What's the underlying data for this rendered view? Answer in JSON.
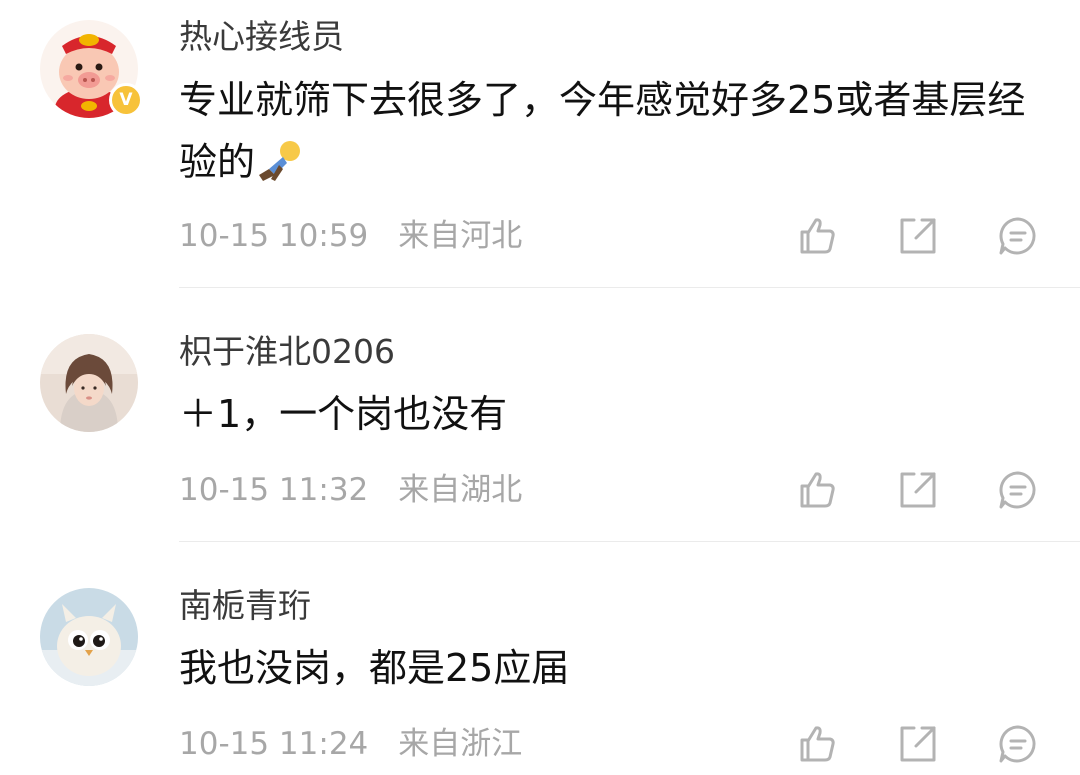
{
  "comments": [
    {
      "username": "热心接线员",
      "text": "专业就筛下去很多了，今年感觉好多25或者基层经验的",
      "emoji": "person-lying-icon",
      "time": "10-15 10:59",
      "location": "来自河北",
      "verified": true,
      "avatar": "pig-avatar"
    },
    {
      "username": "枳于淮北0206",
      "text": "＋1，一个岗也没有",
      "time": "10-15 11:32",
      "location": "来自湖北",
      "verified": false,
      "avatar": "girl-photo-avatar"
    },
    {
      "username": "南栀青珩",
      "text": "我也没岗，都是25应届",
      "time": "10-15 11:24",
      "location": "来自浙江",
      "verified": false,
      "avatar": "owl-chick-avatar"
    }
  ],
  "actions": [
    "like-icon",
    "share-icon",
    "comment-icon"
  ],
  "colors": {
    "username": "#3a3a3a",
    "text": "#111111",
    "meta": "#a7a7a7",
    "icon": "#b3b3b3",
    "divider": "#ebebeb",
    "verified_badge": "#f7c23a"
  }
}
